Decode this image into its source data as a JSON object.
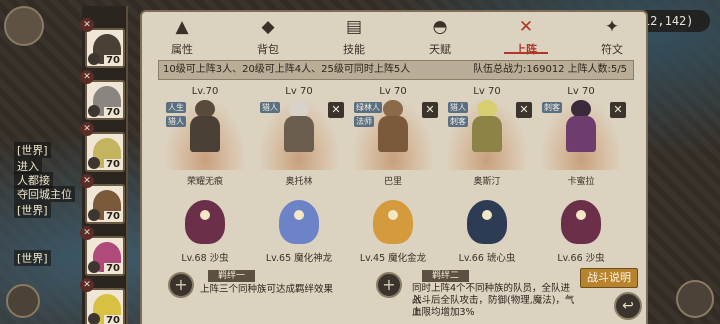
{
  "coords": "(112,142)",
  "chat": [
    {
      "text": "[世界]"
    },
    {
      "text": "进入"
    },
    {
      "text": "人都接"
    },
    {
      "text": "夺回城主位"
    },
    {
      "text": "[世界]"
    },
    {
      "text": "[世界]"
    }
  ],
  "tabs": [
    {
      "label": "属性",
      "icon": "building-icon"
    },
    {
      "label": "背包",
      "icon": "bag-icon"
    },
    {
      "label": "技能",
      "icon": "book-icon"
    },
    {
      "label": "天赋",
      "icon": "hat-icon"
    },
    {
      "label": "上阵",
      "icon": "swords-icon",
      "active": true
    },
    {
      "label": "符文",
      "icon": "rune-icon"
    }
  ],
  "info": {
    "rule": "10级可上阵3人、20级可上阵4人、25级可同时上阵5人",
    "power": "队伍总战力:169012",
    "count": "上阵人数:5/5"
  },
  "roster_level": "70",
  "formation": [
    {
      "level": "Lv.70",
      "name": "荣耀无痕",
      "tags": [
        "人生",
        "猎人"
      ],
      "has_close": false,
      "color": "#4a4036"
    },
    {
      "level": "Lv 70",
      "name": "奥托林",
      "tags": [
        "猎人"
      ],
      "has_close": true,
      "color": "#6b5e4e"
    },
    {
      "level": "Lv 70",
      "name": "巴里",
      "tags": [
        "绿林人",
        "法师"
      ],
      "has_close": true,
      "color": "#7a5a3a"
    },
    {
      "level": "Lv 70",
      "name": "奥斯汀",
      "tags": [
        "猎人",
        "刺客"
      ],
      "has_close": true,
      "color": "#8c8446"
    },
    {
      "level": "Lv 70",
      "name": "卡蜜拉",
      "tags": [
        "刺客"
      ],
      "has_close": true,
      "color": "#6e3d6e"
    }
  ],
  "pets": [
    {
      "label": "Lv.68 沙虫",
      "color": "#6b2f4a"
    },
    {
      "label": "Lv.65 魔化神龙",
      "color": "#6d83c7"
    },
    {
      "label": "Lv.45 魔化金龙",
      "color": "#d49a3c"
    },
    {
      "label": "Lv.66 琥心虫",
      "color": "#2e3b55"
    },
    {
      "label": "Lv.66 沙虫",
      "color": "#6b2f4a"
    }
  ],
  "bonds": {
    "one_title": "羁绊一",
    "one_desc": "上阵三个同种族可达成羁绊效果",
    "two_title": "羁绊二",
    "two_desc_1": "同时上阵4个不同种族的队员，全队进入",
    "two_desc_2": "战斗后全队攻击，防御(物理,魔法)，气血",
    "two_desc_3": "上限均增加3%"
  },
  "battle_button": "战斗说明",
  "close_glyph": "✕",
  "back_glyph": "↩"
}
